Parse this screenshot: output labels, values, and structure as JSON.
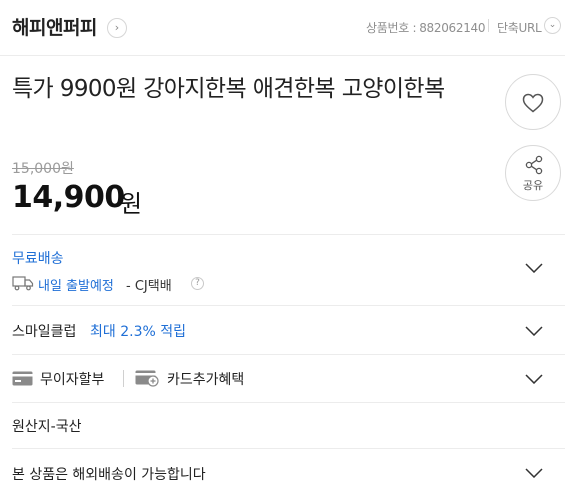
{
  "header": {
    "store_name": "해피앤퍼피",
    "store_chevron": "›",
    "product_number_label": "상품번호 :",
    "product_number": "882062140",
    "short_url_label": "단축URL"
  },
  "product": {
    "title": "특가 9900원 강아지한복 애견한복 고양이한복",
    "original_price": "15,000원",
    "sale_price": "14,900",
    "sale_unit": "원"
  },
  "actions": {
    "share_label": "공유"
  },
  "shipping": {
    "title": "무료배송",
    "eta": "내일 출발예정",
    "carrier": "- CJ택배",
    "help": "?"
  },
  "smile_club": {
    "label": "스마일클럽",
    "value": "최대 2.3% 적립"
  },
  "payment": {
    "installment": "무이자할부",
    "card_benefit": "카드추가혜택"
  },
  "origin": {
    "text": "원산지-국산"
  },
  "international": {
    "text": "본 상품은 해외배송이 가능합니다"
  },
  "colors": {
    "accent_blue": "#1f6fd6",
    "text": "#222222",
    "muted": "#9b9b9b",
    "divider": "#ececec"
  },
  "icons": [
    "chevron-right-icon",
    "chevron-down-icon",
    "heart-icon",
    "share-icon",
    "truck-icon",
    "help-icon",
    "card-icon",
    "card-plus-icon"
  ]
}
